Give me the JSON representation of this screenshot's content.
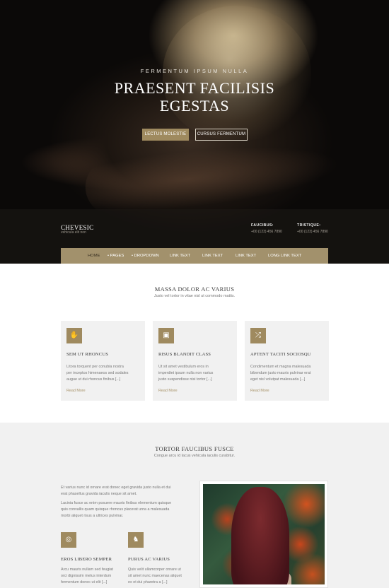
{
  "hero": {
    "subtitle": "FERMENTUM IPSUM NULLA",
    "title_line1": "PRAESENT FACILISIS",
    "title_line2": "EGESTAS",
    "primary_button": "LECTUS MOLESTIE",
    "secondary_button": "CURSUS FERMENTUM"
  },
  "brand": {
    "name": "CHEVESIC",
    "tagline": "vehicula elit non"
  },
  "contacts": [
    {
      "label": "FAUCIBUS:",
      "value": "+00 (123) 456 7890"
    },
    {
      "label": "TRISTIQUE:",
      "value": "+00 (123) 456 7890"
    }
  ],
  "nav": {
    "items": [
      {
        "label": "HOME"
      },
      {
        "label": "• PAGES"
      },
      {
        "label": "• DROPDOWN"
      },
      {
        "label": "LINK TEXT"
      },
      {
        "label": "LINK TEXT"
      },
      {
        "label": "LINK TEXT"
      },
      {
        "label": "LONG LINK TEXT"
      }
    ]
  },
  "section1": {
    "title": "MASSA DOLOR AC VARIUS",
    "subtitle": "Justo vel tortor in vitae nisl ut commodo mattis.",
    "cards": [
      {
        "icon": "hand-icon",
        "title": "SEM UT RHONCUS",
        "line1": "Litora torquent per conubia nostra",
        "line2": "per inceptos himenaeos sed sodales",
        "line3": "augue ut dui rhoncus finibus [...]",
        "more": "Read More"
      },
      {
        "icon": "id-card-icon",
        "title": "RISUS BLANDIT CLASS",
        "line1": "Ut sit amet vestibulum eros in",
        "line2": "imperdiet ipsum nulla non varius",
        "line3": "justo suspendisse nisi tortor [...]",
        "more": "Read More"
      },
      {
        "icon": "shuffle-icon",
        "title": "APTENT TACITI SOCIOSQU",
        "line1": "Condimentum et magna malesuada",
        "line2": "bibendum justo mauris pulvinar erat",
        "line3": "eget nisl volutpat malesuada [...]",
        "more": "Read More"
      }
    ]
  },
  "section2": {
    "title": "TORTOR FAUCIBUS FUSCE",
    "subtitle": "Congue arcu id lacus vehicula iaculis curabitur.",
    "para1_line1": "Et varius nunc id ornare erat donec eget gravida justo nulla et dui",
    "para1_line2": "erat phasellus gravida iaculis neque sit amet.",
    "para2_line1": "Lacinia fusce ac enim posuere mauris finibus elementum quisque",
    "para2_line2": "quis convallis quam quisque rhoncus placerat urna a malesuada",
    "para2_line3": "morbi aliquet risus a ultrices pulvinar.",
    "features": [
      {
        "icon": "swirl-icon",
        "title": "EROS LIBERO SEMPER",
        "line1": "Arcu mauris nullam sed feugiat",
        "line2": "orci dignissim metus interdum",
        "line3": "fermentum donec ut elit [...]"
      },
      {
        "icon": "emblem-icon",
        "title": "PURUS AC VARIUS",
        "line1": "Quis velit ullamcorper ornare ut",
        "line2": "sit amet nunc maecenas aliquet",
        "line3": "ex et dui pharetra a [...]"
      }
    ]
  },
  "colors": {
    "accent": "#9f8a5f",
    "nav_bg": "#a2916c",
    "light_bg": "#f1f1f1"
  }
}
